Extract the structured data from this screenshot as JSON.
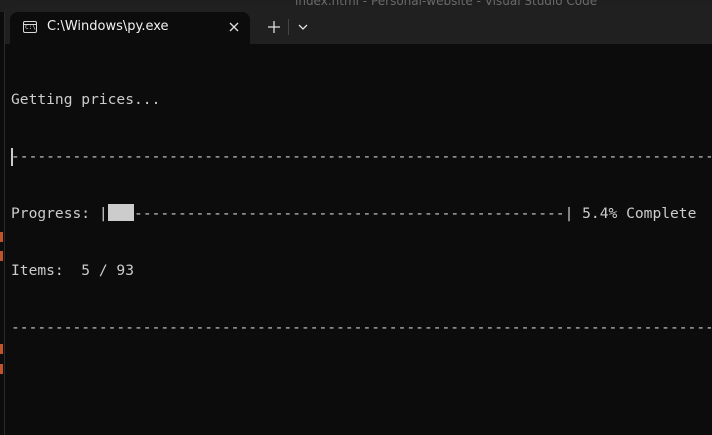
{
  "background_window": {
    "title": "index.html - Personal-website - Visual Studio Code"
  },
  "tab": {
    "icon_label": "C:\\",
    "title": "C:\\Windows\\py.exe"
  },
  "icons": {
    "tab_icon": "terminal-icon",
    "close": "close-icon",
    "new_tab": "plus-icon",
    "dropdown": "chevron-down-icon"
  },
  "console": {
    "status": "Getting prices...",
    "separator": "------------------------------------------------------------------------------------------------",
    "progress_label": "Progress: |",
    "progress_fraction": 0.054,
    "progress_bar_remainder": "-------------------------------------------------",
    "progress_end": "| 5.4% Complete",
    "items_line": "Items:  5 / 93",
    "separator_bottom": "------------------------------------------------------------------------------------------------"
  },
  "colors": {
    "terminal_bg": "#0c0c0c",
    "tabbar_bg": "#202020",
    "text": "#cccccc"
  }
}
